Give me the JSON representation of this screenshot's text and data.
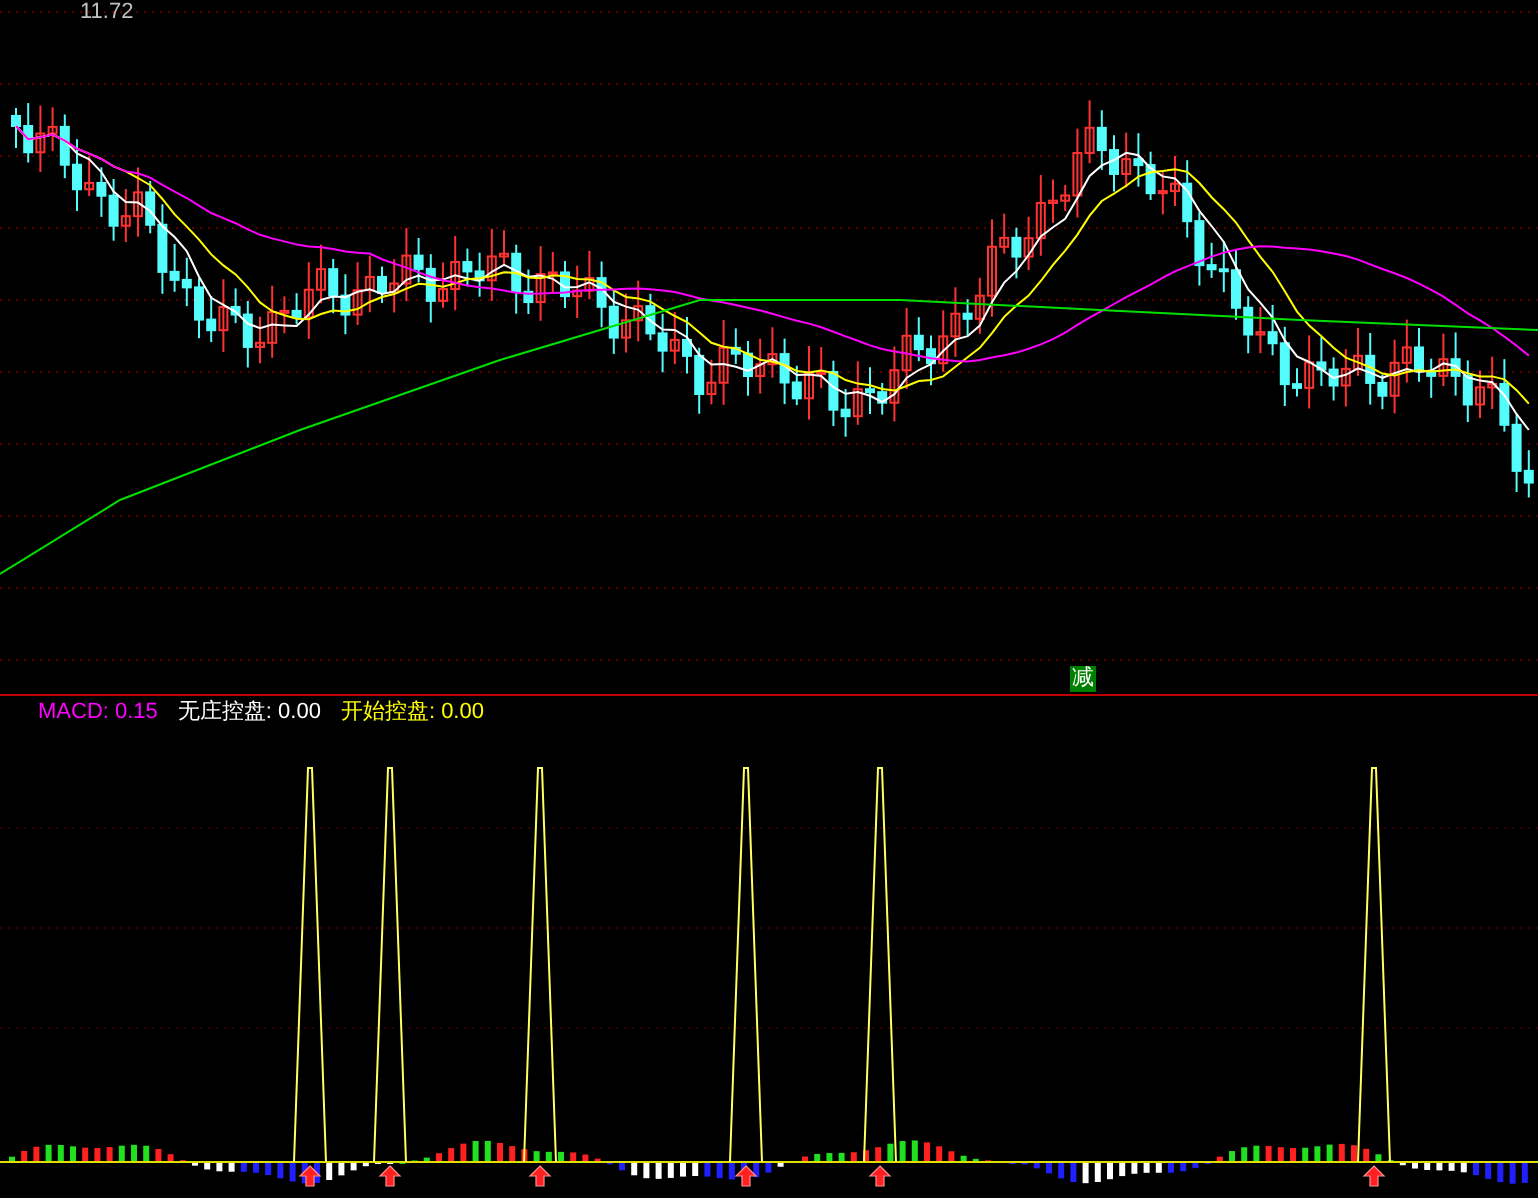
{
  "price_panel": {
    "price_label": "11.72",
    "signal_tag": "减"
  },
  "indicator_panel": {
    "legend": [
      {
        "label": "MACD: 0.15",
        "color": "#ff00ff"
      },
      {
        "label": "无庄控盘: 0.00",
        "color": "#ffffff"
      },
      {
        "label": "开始控盘: 0.00",
        "color": "#ffff00"
      }
    ]
  }
}
